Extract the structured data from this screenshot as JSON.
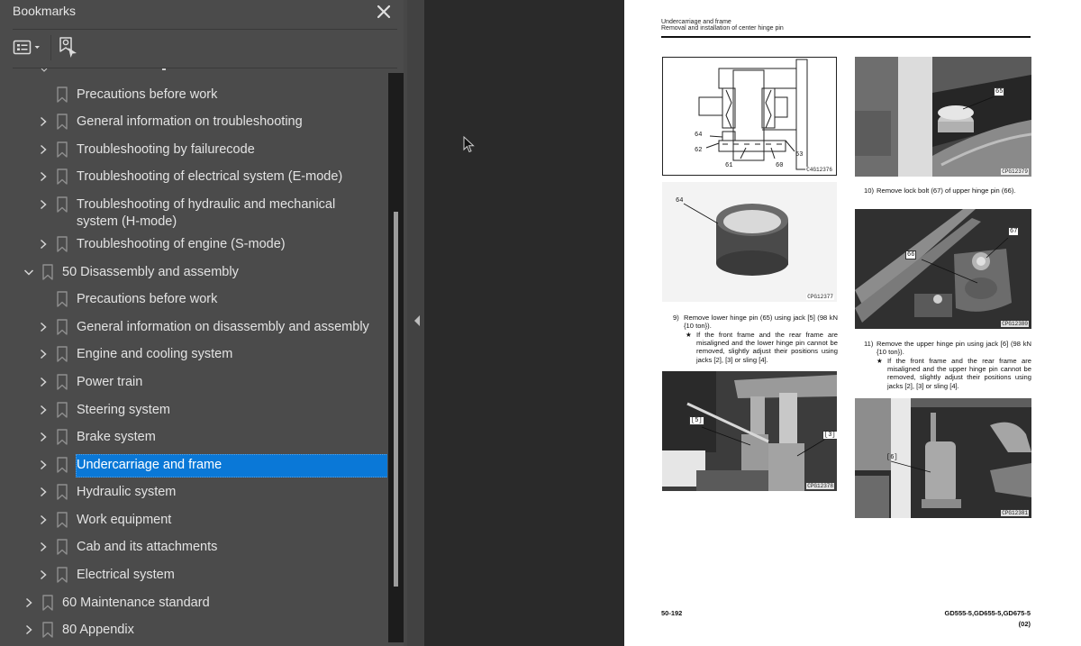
{
  "bookmarks_panel": {
    "title": "Bookmarks",
    "close_icon": "close-icon",
    "toolbar": {
      "options_icon": "list-options-icon",
      "find_current_icon": "find-current-bookmark-icon"
    },
    "items": [
      {
        "label": "Precautions before work",
        "level": 2,
        "expandable": false,
        "expanded": false,
        "selected": false
      },
      {
        "label": "General information on troubleshooting",
        "level": 2,
        "expandable": true,
        "expanded": false,
        "selected": false
      },
      {
        "label": "Troubleshooting by failurecode",
        "level": 2,
        "expandable": true,
        "expanded": false,
        "selected": false
      },
      {
        "label": "Troubleshooting of electrical system (E-mode)",
        "level": 2,
        "expandable": true,
        "expanded": false,
        "selected": false
      },
      {
        "label": "Troubleshooting of hydraulic and mechanical system (H-mode)",
        "level": 2,
        "expandable": true,
        "expanded": false,
        "selected": false
      },
      {
        "label": "Troubleshooting of engine (S-mode)",
        "level": 2,
        "expandable": true,
        "expanded": false,
        "selected": false
      },
      {
        "label": "50 Disassembly and assembly",
        "level": 1,
        "expandable": true,
        "expanded": true,
        "selected": false
      },
      {
        "label": "Precautions before work",
        "level": 2,
        "expandable": false,
        "expanded": false,
        "selected": false
      },
      {
        "label": "General information on disassembly and assembly",
        "level": 2,
        "expandable": true,
        "expanded": false,
        "selected": false
      },
      {
        "label": "Engine and cooling system",
        "level": 2,
        "expandable": true,
        "expanded": false,
        "selected": false
      },
      {
        "label": "Power train",
        "level": 2,
        "expandable": true,
        "expanded": false,
        "selected": false
      },
      {
        "label": "Steering system",
        "level": 2,
        "expandable": true,
        "expanded": false,
        "selected": false
      },
      {
        "label": "Brake system",
        "level": 2,
        "expandable": true,
        "expanded": false,
        "selected": false
      },
      {
        "label": "Undercarriage and frame",
        "level": 2,
        "expandable": true,
        "expanded": false,
        "selected": true
      },
      {
        "label": "Hydraulic system",
        "level": 2,
        "expandable": true,
        "expanded": false,
        "selected": false
      },
      {
        "label": "Work equipment",
        "level": 2,
        "expandable": true,
        "expanded": false,
        "selected": false
      },
      {
        "label": "Cab and its attachments",
        "level": 2,
        "expandable": true,
        "expanded": false,
        "selected": false
      },
      {
        "label": "Electrical system",
        "level": 2,
        "expandable": true,
        "expanded": false,
        "selected": false
      },
      {
        "label": "60 Maintenance standard",
        "level": 1,
        "expandable": true,
        "expanded": false,
        "selected": false
      },
      {
        "label": "80 Appendix",
        "level": 1,
        "expandable": true,
        "expanded": false,
        "selected": false
      }
    ],
    "colors": {
      "panel_bg": "#4b4b4b",
      "selection": "#0a78d7",
      "text": "#e3e3e3"
    }
  },
  "splitter": {
    "collapse_icon": "collapse-left-icon"
  },
  "document_page": {
    "header_line1": "Undercarriage and frame",
    "header_line2": "Removal and installation of center hinge pin",
    "figures": [
      {
        "id": "fig1",
        "code": "C4G12376",
        "callouts": [
          "64",
          "62",
          "61",
          "60",
          "63"
        ]
      },
      {
        "id": "fig2",
        "code": "CPG12379",
        "callouts": [
          "65"
        ]
      },
      {
        "id": "fig3",
        "code": "CPG12377",
        "callouts": [
          "64"
        ]
      },
      {
        "id": "fig4",
        "code": "CPG12380",
        "callouts": [
          "67",
          "66"
        ]
      },
      {
        "id": "fig5",
        "code": "CPG12378",
        "callouts": [
          "[5]",
          "[3]"
        ]
      },
      {
        "id": "fig6",
        "code": "CPG12381",
        "callouts": [
          "[6]"
        ]
      }
    ],
    "steps": {
      "s9": {
        "num": "9)",
        "text": "Remove lower hinge pin (65) using jack [5] (98 kN {10 ton}).",
        "note": "If the front frame and the rear frame are misaligned and the lower hinge pin cannot be removed, slightly adjust their positions using jacks [2], [3] or sling [4]."
      },
      "s10": {
        "num": "10)",
        "text": "Remove lock bolt (67) of upper hinge pin (66)."
      },
      "s11": {
        "num": "11)",
        "text": "Remove the upper hinge pin using jack [6] (98 kN {10 ton}).",
        "note": "If the front frame and the rear frame are misaligned and the upper hinge pin cannot be removed, slightly adjust their positions using jacks [2], [3] or sling [4]."
      }
    },
    "note_marker": "★",
    "page_number": "50-192",
    "models": "GD555-5,GD655-5,GD675-5",
    "revision": "(02)"
  }
}
